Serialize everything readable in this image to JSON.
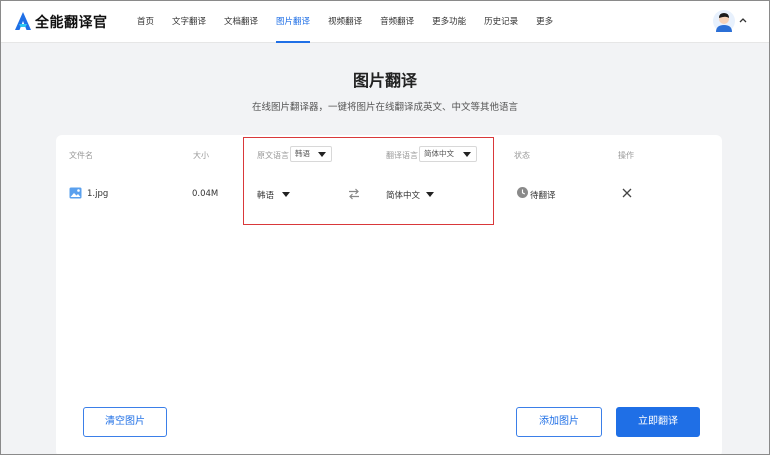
{
  "header": {
    "brand": "全能翻译官",
    "nav": [
      {
        "label": "首页",
        "active": false
      },
      {
        "label": "文字翻译",
        "active": false
      },
      {
        "label": "文档翻译",
        "active": false
      },
      {
        "label": "图片翻译",
        "active": true
      },
      {
        "label": "视频翻译",
        "active": false
      },
      {
        "label": "音频翻译",
        "active": false
      },
      {
        "label": "更多功能",
        "active": false
      },
      {
        "label": "历史记录",
        "active": false
      },
      {
        "label": "更多",
        "active": false
      }
    ],
    "accent": "#1f6fe6"
  },
  "page": {
    "title": "图片翻译",
    "subtitle": "在线图片翻译器，一键将图片在线翻译成英文、中文等其他语言"
  },
  "table": {
    "headers": {
      "filename": "文件名",
      "size": "大小",
      "source_lang": "原文语言",
      "target_lang": "翻译语言",
      "status": "状态",
      "action": "操作"
    },
    "header_source_select": "韩语",
    "header_target_select": "简体中文",
    "rows": [
      {
        "filename": "1.jpg",
        "size": "0.04M",
        "source_lang": "韩语",
        "target_lang": "简体中文",
        "status": "待翻译"
      }
    ]
  },
  "buttons": {
    "clear": "清空图片",
    "add": "添加图片",
    "translate": "立即翻译"
  },
  "highlight_color": "#d9383a"
}
